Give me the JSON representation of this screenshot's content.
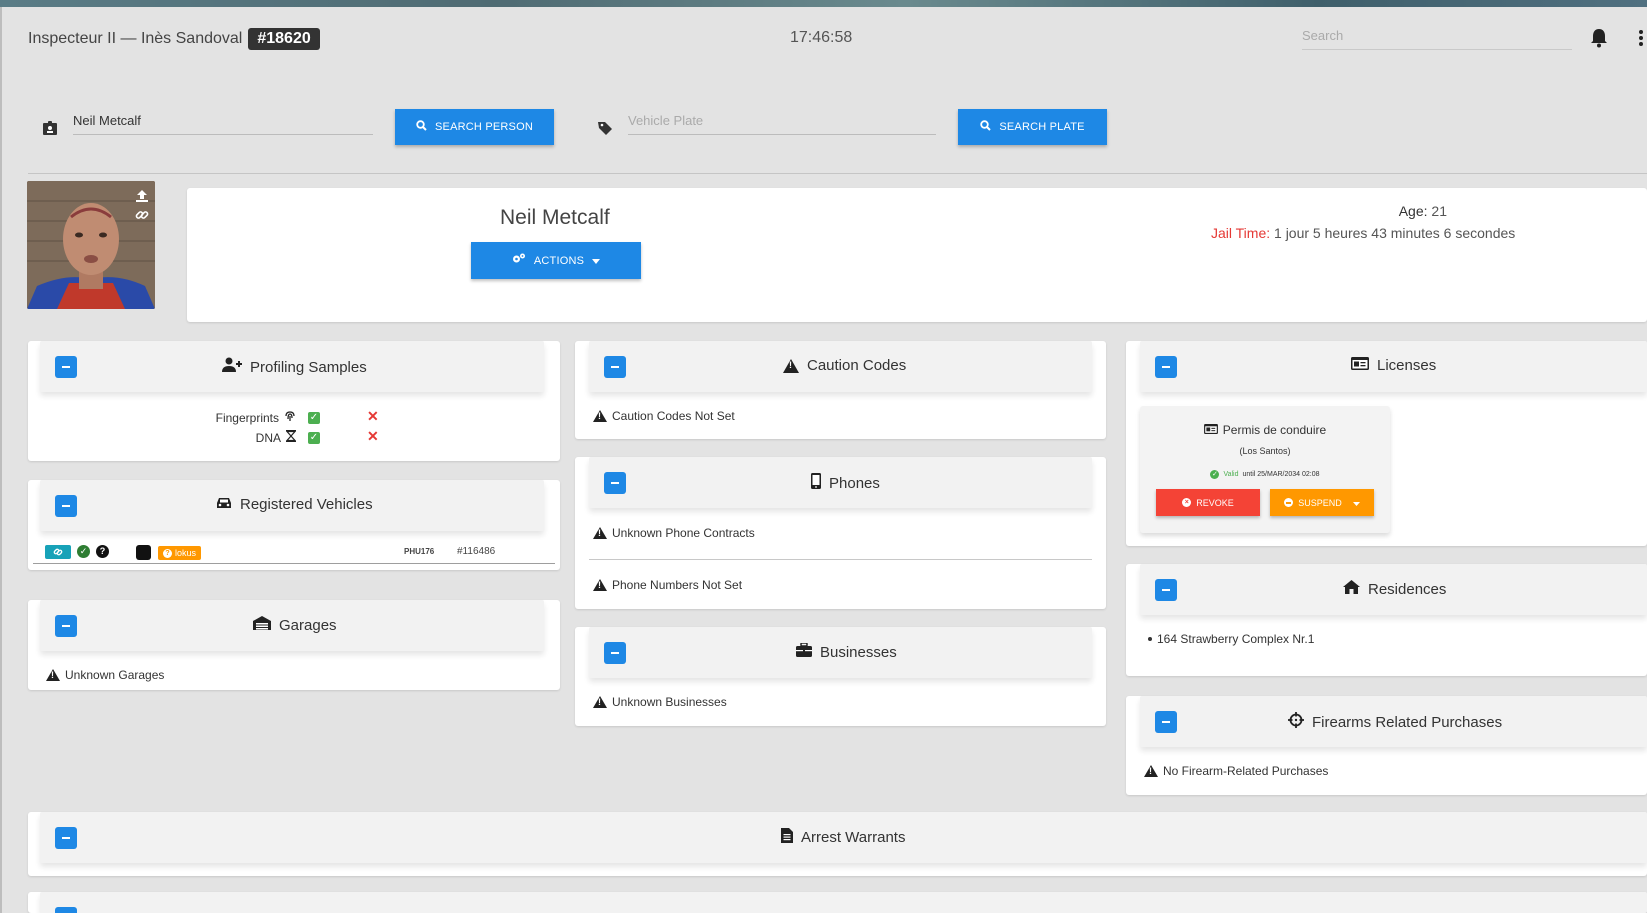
{
  "header": {
    "rank_name": "Inspecteur II — Inès Sandoval",
    "badge": "#18620",
    "clock": "17:46:58",
    "search_placeholder": "Search"
  },
  "search_bar": {
    "person_value": "Neil Metcalf",
    "person_button": "SEARCH PERSON",
    "plate_placeholder": "Vehicle Plate",
    "plate_button": "SEARCH PLATE"
  },
  "profile": {
    "name": "Neil Metcalf",
    "actions_label": "ACTIONS",
    "age_label": "Age:",
    "age_value": "21",
    "jail_label": "Jail Time:",
    "jail_value": "1 jour 5 heures 43 minutes 6 secondes"
  },
  "profiling": {
    "title": "Profiling Samples",
    "rows": [
      {
        "label": "Fingerprints"
      },
      {
        "label": "DNA"
      }
    ]
  },
  "vehicles": {
    "title": "Registered Vehicles",
    "tag": "lokus",
    "plate": "PHU176",
    "id": "#116486"
  },
  "garages": {
    "title": "Garages",
    "empty": "Unknown Garages"
  },
  "caution": {
    "title": "Caution Codes",
    "empty": "Caution Codes Not Set"
  },
  "phones": {
    "title": "Phones",
    "contracts": "Unknown Phone Contracts",
    "numbers": "Phone Numbers Not Set"
  },
  "businesses": {
    "title": "Businesses",
    "empty": "Unknown Businesses"
  },
  "licenses": {
    "title": "Licenses",
    "item": {
      "name": "Permis de conduire",
      "region": "(Los Santos)",
      "valid_word": "Valid",
      "valid_rest": "until 25/MAR/2034 02:08",
      "revoke": "REVOKE",
      "suspend": "SUSPEND"
    }
  },
  "residences": {
    "title": "Residences",
    "items": [
      "164 Strawberry Complex Nr.1"
    ]
  },
  "firearms": {
    "title": "Firearms Related Purchases",
    "empty": "No Firearm-Related Purchases"
  },
  "warrants": {
    "title": "Arrest Warrants"
  },
  "colors": {
    "accent": "#1e88e5",
    "danger": "#f44336",
    "warning": "#ff9800",
    "success": "#4caf50"
  }
}
